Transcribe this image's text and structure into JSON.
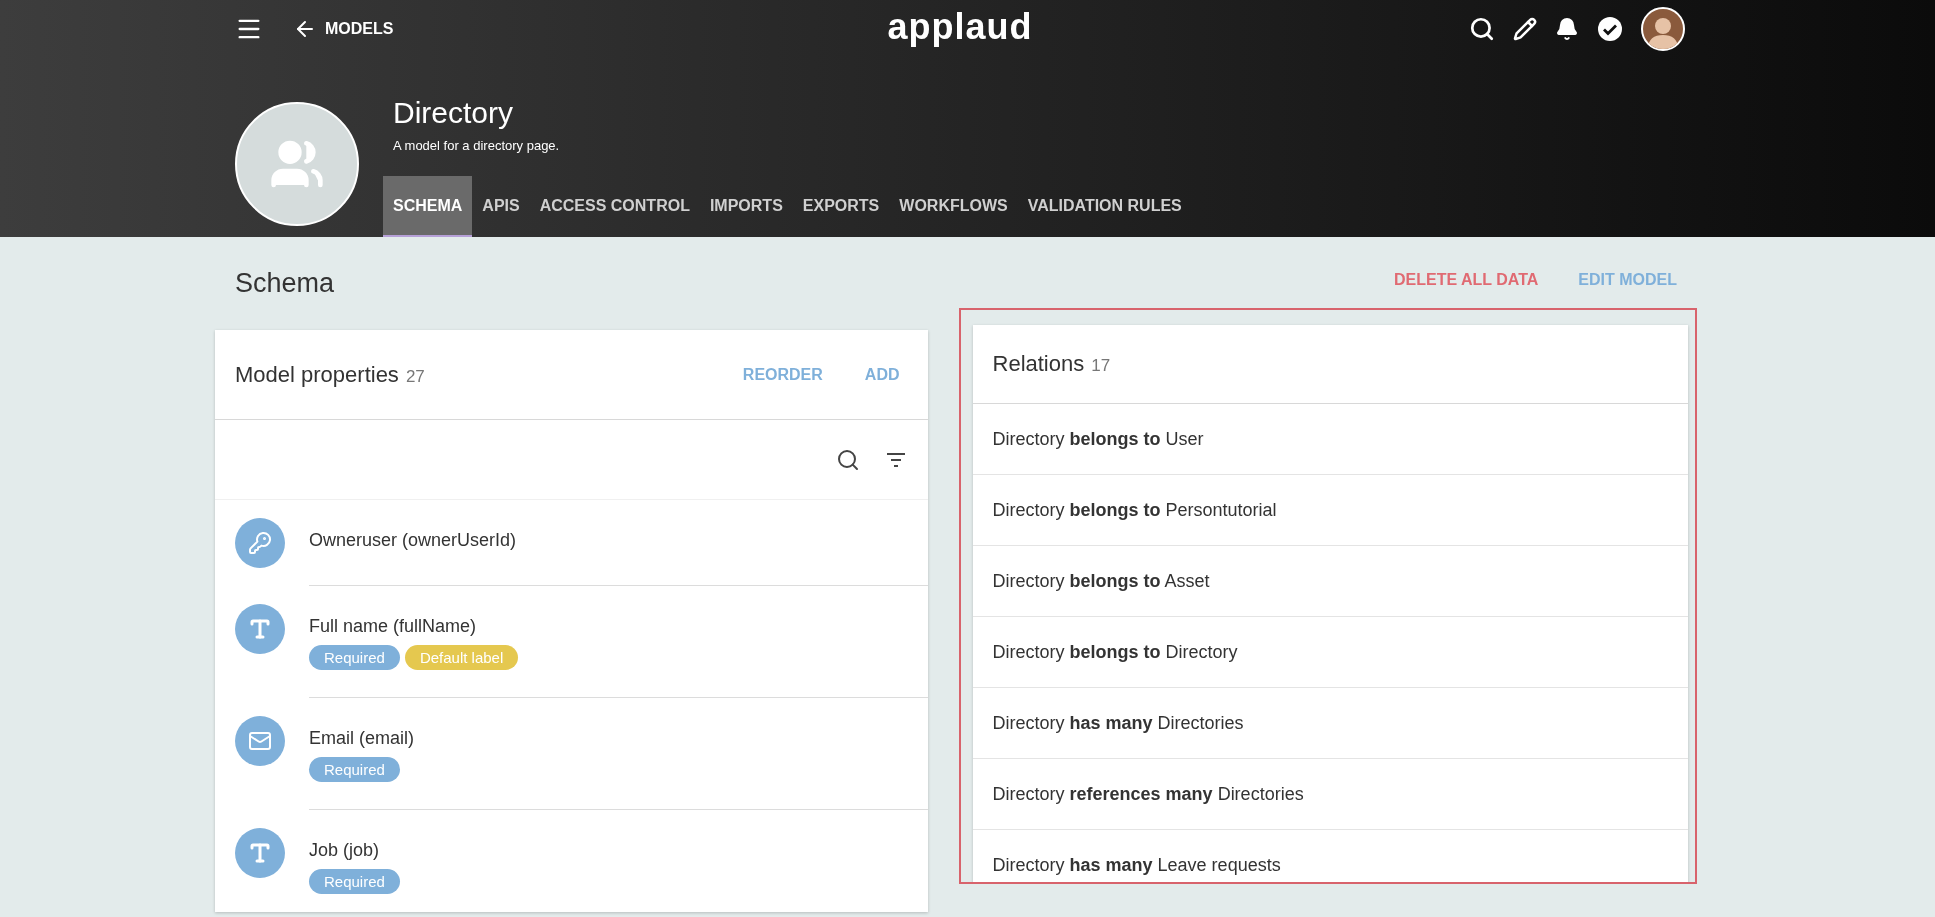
{
  "top_bar": {
    "back_label": "MODELS",
    "logo": "applaud"
  },
  "model": {
    "name": "Directory",
    "description": "A model for a directory page."
  },
  "tabs": [
    {
      "label": "SCHEMA",
      "selected": true
    },
    {
      "label": "APIS",
      "selected": false
    },
    {
      "label": "ACCESS CONTROL",
      "selected": false
    },
    {
      "label": "IMPORTS",
      "selected": false
    },
    {
      "label": "EXPORTS",
      "selected": false
    },
    {
      "label": "WORKFLOWS",
      "selected": false
    },
    {
      "label": "VALIDATION RULES",
      "selected": false
    }
  ],
  "page_title": "Schema",
  "actions": [
    {
      "label": "DELETE ALL DATA",
      "kind": "danger"
    },
    {
      "label": "EDIT MODEL",
      "kind": "primary"
    }
  ],
  "properties": {
    "title": "Model properties",
    "count": "27",
    "actions": [
      "REORDER",
      "ADD"
    ],
    "items": [
      {
        "label": "Owneruser (ownerUserId)",
        "kind": "key"
      },
      {
        "label": "Full name (fullName)",
        "kind": "text",
        "tags": [
          {
            "label": "Required",
            "color": "#7fb0da"
          },
          {
            "label": "Default label",
            "color": "#e5c84f"
          }
        ]
      },
      {
        "label": "Email (email)",
        "kind": "email",
        "tags": [
          {
            "label": "Required",
            "color": "#7fb0da"
          }
        ]
      },
      {
        "label": "Job (job)",
        "kind": "text",
        "tags": [
          {
            "label": "Required",
            "color": "#7fb0da"
          }
        ]
      }
    ]
  },
  "relations": {
    "title": "Relations",
    "count": "17",
    "items": [
      "Directory **belongs to** User",
      "Directory **belongs to** Persontutorial",
      "Directory **belongs to** Asset",
      "Directory **belongs to** Directory",
      "Directory **has many** Directories",
      "Directory **references many** Directories",
      "Directory **has many** Leave requests"
    ]
  }
}
